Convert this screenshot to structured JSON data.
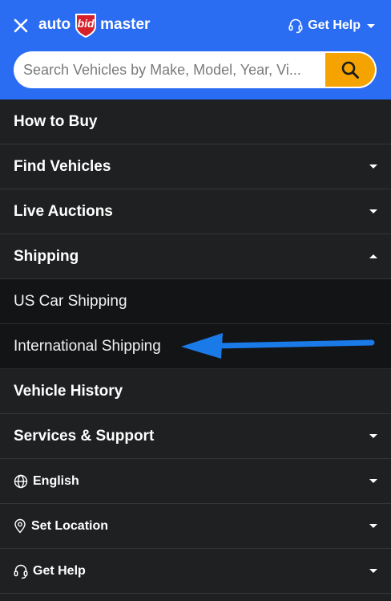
{
  "header": {
    "logo": {
      "left": "auto",
      "shield": "bid",
      "right": "master"
    },
    "help_label": "Get Help",
    "search_placeholder": "Search Vehicles by Make, Model, Year, Vi..."
  },
  "menu": [
    {
      "label": "How to Buy",
      "caret": "none"
    },
    {
      "label": "Find Vehicles",
      "caret": "down"
    },
    {
      "label": "Live Auctions",
      "caret": "down"
    },
    {
      "label": "Shipping",
      "caret": "up"
    },
    {
      "label": "US Car Shipping",
      "sub": true
    },
    {
      "label": "International Shipping",
      "sub": true
    },
    {
      "label": "Vehicle History",
      "caret": "none"
    },
    {
      "label": "Services & Support",
      "caret": "down"
    },
    {
      "label": "English",
      "caret": "down",
      "icon": "globe-icon"
    },
    {
      "label": "Set Location",
      "caret": "down",
      "icon": "location-pin-icon"
    },
    {
      "label": "Get Help",
      "caret": "down",
      "icon": "headset-icon"
    }
  ],
  "colors": {
    "header_bg": "#2b6df2",
    "search_button": "#f5a300",
    "menu_bg": "#1f2022",
    "submenu_bg": "#131416",
    "logo_shield": "#d6202a",
    "annotation_arrow": "#1a7ae8"
  }
}
